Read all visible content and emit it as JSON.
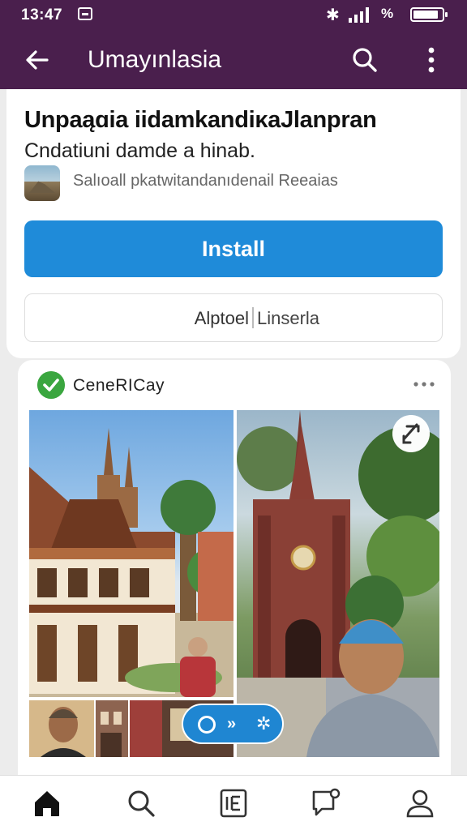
{
  "status": {
    "time": "13:47",
    "battery_percent_label": "%",
    "battery_level": 0.9,
    "icons": [
      "notification-icon",
      "bluetooth-icon",
      "signal-icon",
      "battery-icon"
    ]
  },
  "appbar": {
    "title": "Umayınlasia",
    "icons": [
      "back-arrow-icon",
      "search-icon",
      "more-vertical-icon"
    ]
  },
  "app": {
    "title": "Unpaąɑia iidamkandiᴋaJlanpran",
    "subtitle": "Cndatiuni damde a hinab.",
    "meta": "Salıoall pkatwitandanıdenail Reeaias",
    "install_label": "Install",
    "secondary_left": "Alptoel",
    "secondary_right": "Linserla"
  },
  "post": {
    "author": "CeneRICay",
    "verified_icon": "check-badge-icon",
    "more_icon": "more-horizontal-icon",
    "pill_icons": [
      "circle-icon",
      "share-icon",
      "sparkle-icon"
    ],
    "corner_icon": "brand-logo-icon"
  },
  "bottom_nav": [
    "home-icon",
    "search-icon",
    "news-icon",
    "messages-icon",
    "profile-icon"
  ],
  "colors": {
    "app_bar": "#4a1f4d",
    "install_button": "#1f8bd9",
    "verified_badge": "#3aa63f"
  }
}
